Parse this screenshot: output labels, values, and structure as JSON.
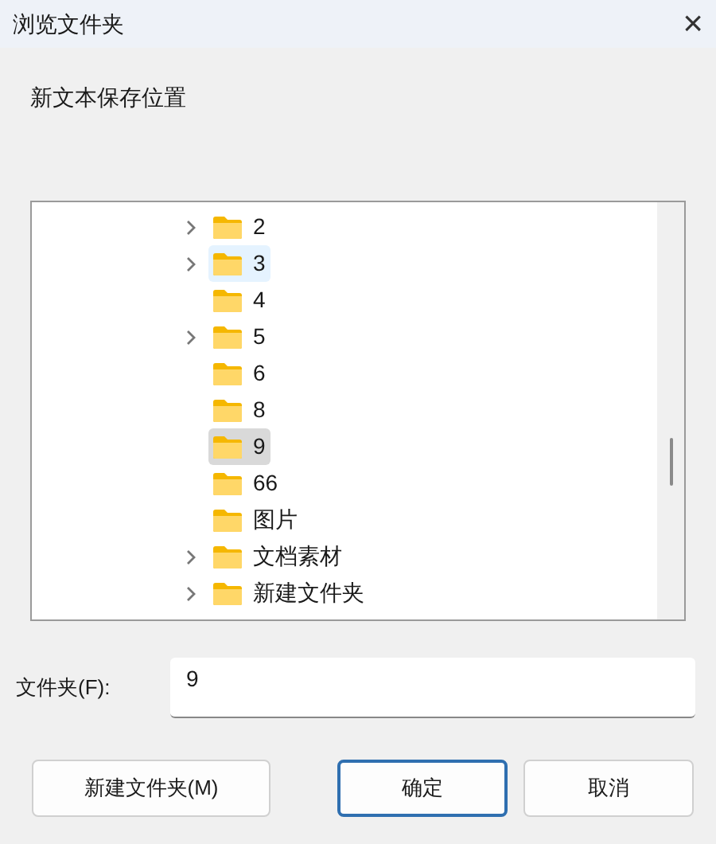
{
  "window": {
    "title": "浏览文件夹",
    "close": "×"
  },
  "prompt": "新文本保存位置",
  "tree": [
    {
      "label": "2",
      "expandable": true,
      "selected": false,
      "hovered": false
    },
    {
      "label": "3",
      "expandable": true,
      "selected": false,
      "hovered": true
    },
    {
      "label": "4",
      "expandable": false,
      "selected": false,
      "hovered": false
    },
    {
      "label": "5",
      "expandable": true,
      "selected": false,
      "hovered": false
    },
    {
      "label": "6",
      "expandable": false,
      "selected": false,
      "hovered": false
    },
    {
      "label": "8",
      "expandable": false,
      "selected": false,
      "hovered": false
    },
    {
      "label": "9",
      "expandable": false,
      "selected": true,
      "hovered": false
    },
    {
      "label": "66",
      "expandable": false,
      "selected": false,
      "hovered": false
    },
    {
      "label": "图片",
      "expandable": false,
      "selected": false,
      "hovered": false
    },
    {
      "label": "文档素材",
      "expandable": true,
      "selected": false,
      "hovered": false
    },
    {
      "label": "新建文件夹",
      "expandable": true,
      "selected": false,
      "hovered": false
    }
  ],
  "folder_field": {
    "label": "文件夹(F):",
    "value": "9"
  },
  "buttons": [
    {
      "label": "新建文件夹(M)",
      "default": false
    },
    {
      "label": "确定",
      "default": true
    },
    {
      "label": "取消",
      "default": false
    }
  ]
}
